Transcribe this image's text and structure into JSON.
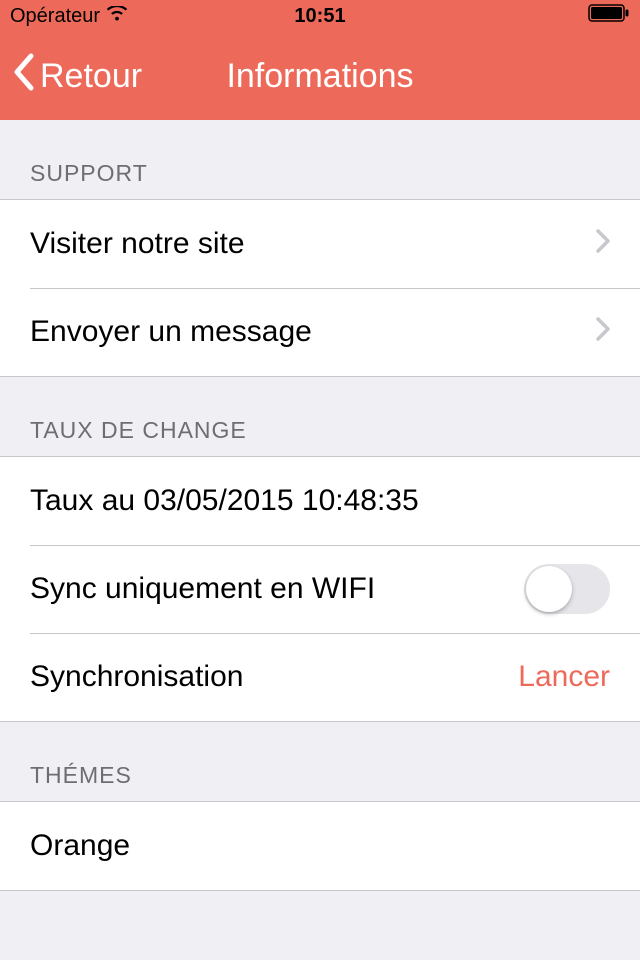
{
  "status": {
    "carrier": "Opérateur",
    "time": "10:51"
  },
  "nav": {
    "back_label": "Retour",
    "title": "Informations"
  },
  "sections": {
    "support": {
      "header": "SUPPORT",
      "visit_site": "Visiter notre site",
      "send_message": "Envoyer un message"
    },
    "exchange": {
      "header": "TAUX DE CHANGE",
      "rate_date": "Taux au 03/05/2015 10:48:35",
      "wifi_sync": "Sync uniquement en WIFI",
      "sync_label": "Synchronisation",
      "sync_action": "Lancer"
    },
    "themes": {
      "header": "THÉMES",
      "current": "Orange"
    }
  }
}
